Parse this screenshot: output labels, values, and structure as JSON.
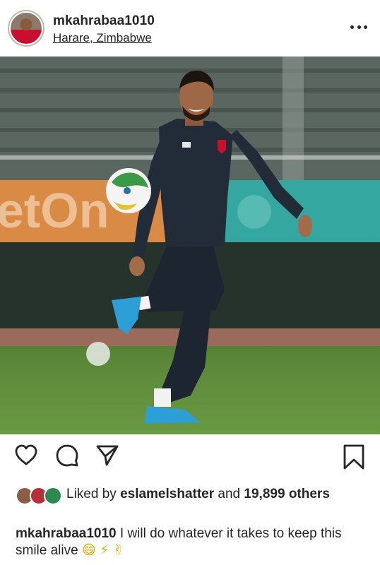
{
  "post": {
    "username": "mkahrabaa1010",
    "location": "Harare, Zimbabwe",
    "more_icon": "more-horizontal-icon"
  },
  "photo": {
    "description_icon": "post-photo",
    "ad_board_text": "etOn"
  },
  "actions": {
    "icons": [
      "heart-icon",
      "comment-icon",
      "share-icon",
      "bookmark-icon"
    ]
  },
  "likes": {
    "prefix": "Liked by",
    "first_user": "eslamelshatter",
    "connector": "and",
    "count": "19,899",
    "suffix": "others"
  },
  "caption": {
    "username": "mkahrabaa1010",
    "text": "I will do whatever it takes to keep this smile alive",
    "emojis": "😄 ⚡ ✌"
  },
  "colors": {
    "text": "#262626",
    "ad_board_orange": "#e07a2e",
    "ad_board_teal": "#2aa6a0",
    "pitch_green": "#5b8a3a"
  }
}
